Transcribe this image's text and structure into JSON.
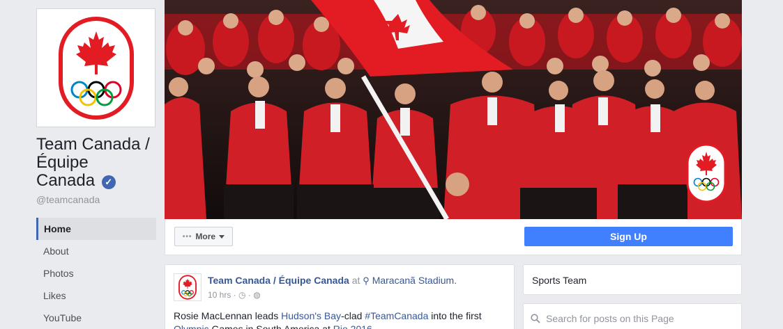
{
  "page": {
    "name": "Team Canada / Équipe Canada",
    "name_lines": [
      "Team Canada /",
      "Équipe",
      "Canada"
    ],
    "handle": "@teamcanada",
    "verified": true,
    "verified_icon": "check-icon"
  },
  "nav": {
    "items": [
      {
        "label": "Home",
        "active": true
      },
      {
        "label": "About",
        "active": false
      },
      {
        "label": "Photos",
        "active": false
      },
      {
        "label": "Likes",
        "active": false
      },
      {
        "label": "YouTube",
        "active": false
      }
    ]
  },
  "cover_actions": {
    "more_label": "More",
    "signup_label": "Sign Up"
  },
  "post": {
    "author": "Team Canada / Équipe Canada",
    "at": "at",
    "place": "Maracanã Stadium.",
    "time": "10 hrs",
    "privacy_icon": "globe-icon",
    "text_1": "Rosie MacLennan leads ",
    "link_1": "Hudson's Bay",
    "text_2": "-clad ",
    "link_2": "#TeamCanada",
    "text_3": " into the first ",
    "link_3": "Olympic",
    "text_4": " Games in South America at ",
    "link_4": "Rio 2016",
    "text_5": "."
  },
  "sidebar": {
    "category": "Sports Team",
    "search_placeholder": "Search for posts on this Page"
  },
  "colors": {
    "brand_blue": "#4267b2",
    "signup_blue": "#4080ff",
    "canada_red": "#e31b23",
    "link": "#365899"
  }
}
